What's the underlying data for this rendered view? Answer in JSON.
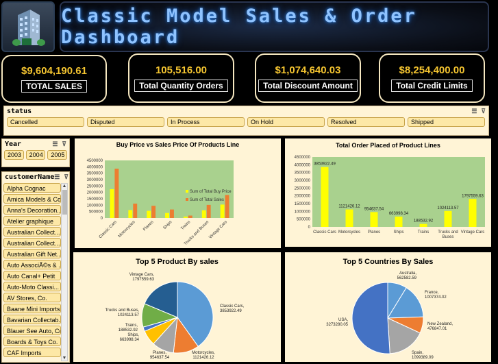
{
  "header": {
    "title": "Classic Model  Sales & Order Dashboard",
    "logo_icon": "building-icon"
  },
  "kpis": [
    {
      "value": "$9,604,190.61",
      "label": "TOTAL SALES"
    },
    {
      "value": "105,516.00",
      "label": "Total Quantity Orders"
    },
    {
      "value": "$1,074,640.03",
      "label": "Total Discount Amount"
    },
    {
      "value": "$8,254,400.00",
      "label": "Total Credit Limits"
    }
  ],
  "status_slicer": {
    "title": "status",
    "items": [
      "Cancelled",
      "Disputed",
      "In Process",
      "On Hold",
      "Resolved",
      "Shipped"
    ]
  },
  "year_slicer": {
    "title": "Year",
    "items": [
      "2003",
      "2004",
      "2005"
    ]
  },
  "customer_slicer": {
    "title": "customerName",
    "items": [
      "Alpha Cognac",
      "Amica Models & Co.",
      "Anna's Decoration...",
      "Atelier graphique",
      "Australian Collect...",
      "Australian Collect...",
      "Australian Gift Net...",
      "Auto AssociÃ©s & ...",
      "Auto Canal+ Petit",
      "Auto-Moto Classi...",
      "AV Stores, Co.",
      "Baane Mini Imports",
      "Bavarian Collectab...",
      "Blauer See Auto, Co.",
      "Boards & Toys Co.",
      "CAF Imports"
    ]
  },
  "colors": {
    "accent_yellow": "#f4c430",
    "buy_bar": "#ffff00",
    "sales_bar": "#ed7d31",
    "plot_green": "#a9d18e",
    "panel_bg": "#fff4d6"
  },
  "chart_data": [
    {
      "type": "bar",
      "title": "Buy Price vs Sales Price Of Products Line",
      "categories": [
        "Classic Cars",
        "Motorcycles",
        "Planes",
        "Ships",
        "Trains",
        "Trucks and Buses",
        "Vintage Cars"
      ],
      "series": [
        {
          "name": "Sum of Total Buy Price",
          "values": [
            2250000,
            620000,
            560000,
            390000,
            110000,
            600000,
            1050000
          ]
        },
        {
          "name": "Sum of Total Sales",
          "values": [
            3853922,
            1121426,
            954637,
            663998,
            188532,
            1024113,
            1797559
          ]
        }
      ],
      "legend": [
        "Sum of Total Buy Price",
        "Sum of Total Sales"
      ],
      "yticks": [
        "0",
        "500000",
        "1000000",
        "1500000",
        "2000000",
        "2500000",
        "3000000",
        "3500000",
        "4000000",
        "4500000"
      ],
      "ylim": [
        0,
        4500000
      ],
      "grid": false,
      "legend_position": "right"
    },
    {
      "type": "bar",
      "title": "Total Order Placed of Product Lines",
      "categories": [
        "Classic Cars",
        "Motorcycles",
        "Planes",
        "Ships",
        "Trains",
        "Trucks and Buses",
        "Vintage Cars"
      ],
      "values": [
        3853922.49,
        1121426.12,
        954637.54,
        663998.34,
        188532.92,
        1024113.57,
        1797559.63
      ],
      "data_labels": [
        "3853922.49",
        "1121426.12",
        "954637.54",
        "663998.34",
        "188532.92",
        "1024113.57",
        "1797559.63"
      ],
      "yticks": [
        "0",
        "500000",
        "1000000",
        "1500000",
        "2000000",
        "2500000",
        "3000000",
        "3500000",
        "4000000",
        "4500000"
      ],
      "ylim": [
        0,
        4500000
      ],
      "grid": false
    },
    {
      "type": "pie",
      "title": "Top 5 Product By sales",
      "slices": [
        {
          "label": "Classic Cars, 3853922.49",
          "value": 3853922.49,
          "color": "#5b9bd5"
        },
        {
          "label": "Motorcycles, 1121426.12",
          "value": 1121426.12,
          "color": "#ed7d31"
        },
        {
          "label": "Planes, 954637.54",
          "value": 954637.54,
          "color": "#a5a5a5"
        },
        {
          "label": "Ships, 663998.34",
          "value": 663998.34,
          "color": "#ffc000"
        },
        {
          "label": "Trains, 188532.92",
          "value": 188532.92,
          "color": "#4472c4"
        },
        {
          "label": "Trucks and Buses, 1024113.57",
          "value": 1024113.57,
          "color": "#70ad47"
        },
        {
          "label": "Vintage Cars, 1797559.63",
          "value": 1797559.63,
          "color": "#255e91"
        }
      ]
    },
    {
      "type": "pie",
      "title": "Top 5 Countries By Sales",
      "slices": [
        {
          "label": "Australia, 562582.59",
          "value": 562582.59,
          "color": "#5b9bd5"
        },
        {
          "label": "France, 1007374.02",
          "value": 1007374.02,
          "color": "#5b9bd5"
        },
        {
          "label": "New Zealand, 476847.01",
          "value": 476847.01,
          "color": "#ed7d31"
        },
        {
          "label": "Spain, 1099389.09",
          "value": 1099389.09,
          "color": "#a5a5a5"
        },
        {
          "label": "USA, 3273280.05",
          "value": 3273280.05,
          "color": "#4472c4"
        }
      ]
    }
  ]
}
